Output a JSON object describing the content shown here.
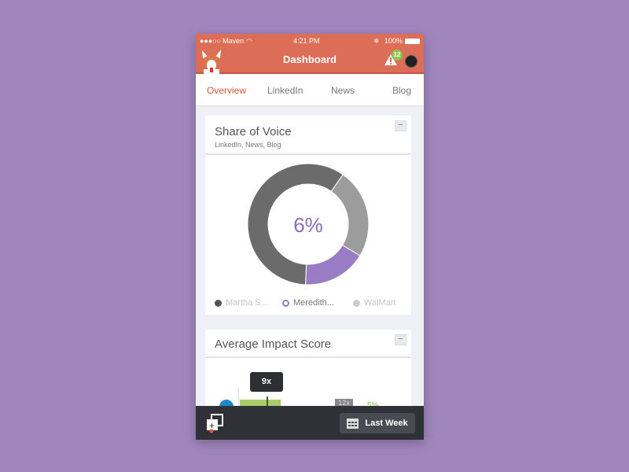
{
  "status_bar": {
    "carrier": "Maven",
    "time": "4:21 PM",
    "battery": "100%",
    "signal_icon": "signal-dots-icon",
    "wifi_icon": "wifi-icon",
    "bluetooth_icon": "bluetooth-icon"
  },
  "header": {
    "title": "Dashboard",
    "alert_count": "12",
    "logo": "corgi-logo"
  },
  "tabs": [
    {
      "label": "Overview",
      "active": true
    },
    {
      "label": "LinkedIn"
    },
    {
      "label": "News"
    },
    {
      "label": "Blog"
    }
  ],
  "share_of_voice": {
    "title": "Share of Voice",
    "subtitle": "LinkedIn, News, Blog",
    "collapse_label": "−",
    "center_label": "6%",
    "chart_data": {
      "type": "pie",
      "series": [
        {
          "name": "Martha S...",
          "value": 59,
          "color": "#6b6b6b"
        },
        {
          "name": "Meredith...",
          "value": 17,
          "color": "#9a7cc4"
        },
        {
          "name": "WalMart",
          "value": 24,
          "color": "#9c9c9c"
        }
      ]
    }
  },
  "impact": {
    "title": "Average Impact Score",
    "collapse_label": "−",
    "tooltip": "9x",
    "score_badge": "12x",
    "change": "5%"
  },
  "bottom_bar": {
    "add_icon": "add-dashboard-icon",
    "date_range": "Last Week",
    "calendar_icon": "calendar-icon"
  }
}
